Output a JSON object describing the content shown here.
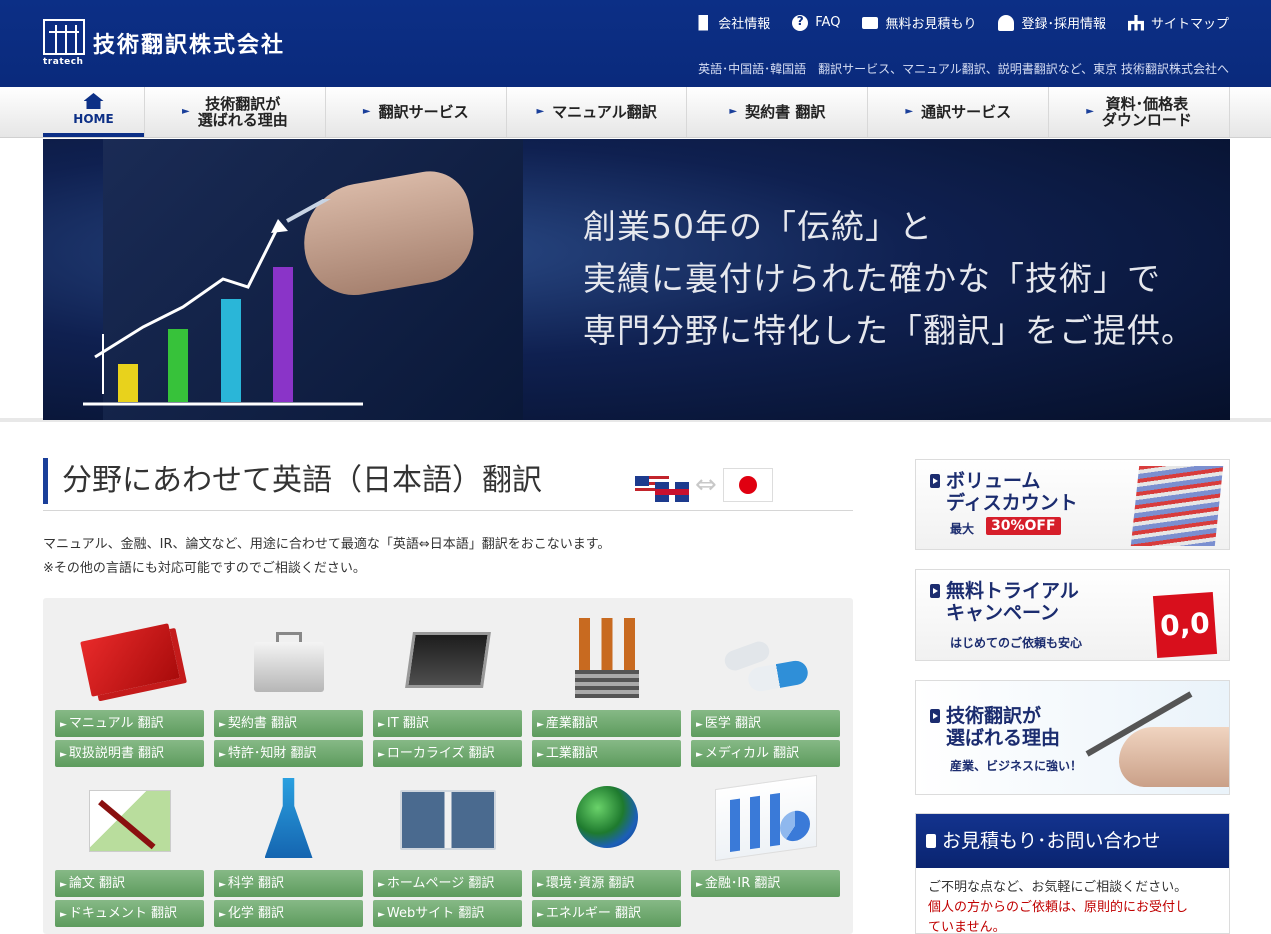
{
  "header": {
    "logo_sub": "tratech",
    "company_name": "技術翻訳株式会社",
    "top_links": [
      {
        "label": "会社情報",
        "icon": "building-icon"
      },
      {
        "label": "FAQ",
        "icon": "faq-icon"
      },
      {
        "label": "無料お見積もり",
        "icon": "chat-icon"
      },
      {
        "label": "登録･採用情報",
        "icon": "user-icon"
      },
      {
        "label": "サイトマップ",
        "icon": "sitemap-icon"
      }
    ],
    "tagline": "英語･中国語･韓国語　翻訳サービス、マニュアル翻訳、説明書翻訳など、東京 技術翻訳株式会社へ"
  },
  "nav": {
    "home": "HOME",
    "items": [
      {
        "line1": "技術翻訳が",
        "line2": "選ばれる理由"
      },
      {
        "line1": "翻訳サービス",
        "line2": ""
      },
      {
        "line1": "マニュアル翻訳",
        "line2": ""
      },
      {
        "line1": "契約書 翻訳",
        "line2": ""
      },
      {
        "line1": "通訳サービス",
        "line2": ""
      },
      {
        "line1": "資料･価格表",
        "line2": "ダウンロード"
      }
    ]
  },
  "hero": {
    "line1": "創業50年の「伝統」と",
    "line2": "実績に裏付けられた確かな「技術」で",
    "line3": "専門分野に特化した「翻訳」をご提供。"
  },
  "section": {
    "title": "分野にあわせて英語（日本語）翻訳",
    "intro1": "マニュアル、金融、IR、論文など、用途に合わせて最適な「英語⇔日本語」翻訳をおこないます。",
    "intro2": "※その他の言語にも対応可能ですのでご相談ください。"
  },
  "categories": {
    "manual": [
      "マニュアル 翻訳",
      "取扱説明書 翻訳"
    ],
    "contract": [
      "契約書 翻訳",
      "特許･知財 翻訳"
    ],
    "it": [
      "IT 翻訳",
      "ローカライズ 翻訳"
    ],
    "industry": [
      "産業翻訳",
      "工業翻訳"
    ],
    "medical": [
      "医学 翻訳",
      "メディカル 翻訳"
    ],
    "paper": [
      "論文 翻訳",
      "ドキュメント 翻訳"
    ],
    "science": [
      "科学 翻訳",
      "化学 翻訳"
    ],
    "web": [
      "ホームページ 翻訳",
      "Webサイト 翻訳"
    ],
    "environment": [
      "環境･資源 翻訳",
      "エネルギー 翻訳"
    ],
    "finance": [
      "金融･IR 翻訳"
    ]
  },
  "sidebar": {
    "volume": {
      "line1": "ボリューム",
      "line2": "ディスカウント",
      "max": "最大",
      "off": "30%OFF"
    },
    "trial": {
      "line1": "無料トライアル",
      "line2": "キャンペーン",
      "sub": "はじめてのご依頼も安心",
      "price": "0,0"
    },
    "reason": {
      "line1": "技術翻訳が",
      "line2": "選ばれる理由",
      "sub": "産業、ビジネスに強い！"
    },
    "contact": {
      "title": "お見積もり･お問い合わせ",
      "line1": "ご不明な点など、お気軽にご相談ください。",
      "line2": "個人の方からのご依頼は、原則的にお受付し",
      "line3": "ていません。"
    }
  },
  "colors": {
    "brand_blue": "#0c2f86",
    "button_green": "#6fa96f",
    "accent_red": "#d61e2a"
  }
}
